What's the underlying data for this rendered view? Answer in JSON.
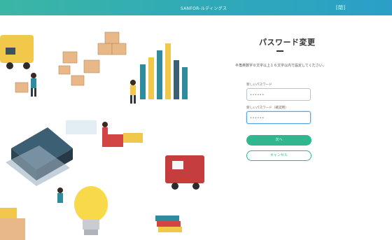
{
  "header": {
    "brand": "SANFOR-ルディングス",
    "close": "[閉]"
  },
  "form": {
    "title": "パスワード変更",
    "description": "半角英数字８文字以上１６文字以内で設定してください。",
    "new_password_label": "新しいパスワード",
    "new_password_value": "••••••",
    "confirm_password_label": "新しいパスワード（確認用）",
    "confirm_password_value": "••••••",
    "submit_label": "次へ",
    "cancel_label": "キャンセル"
  },
  "colors": {
    "header_start": "#3bb6a4",
    "header_end": "#2b9fc8",
    "accent": "#31b68f"
  }
}
